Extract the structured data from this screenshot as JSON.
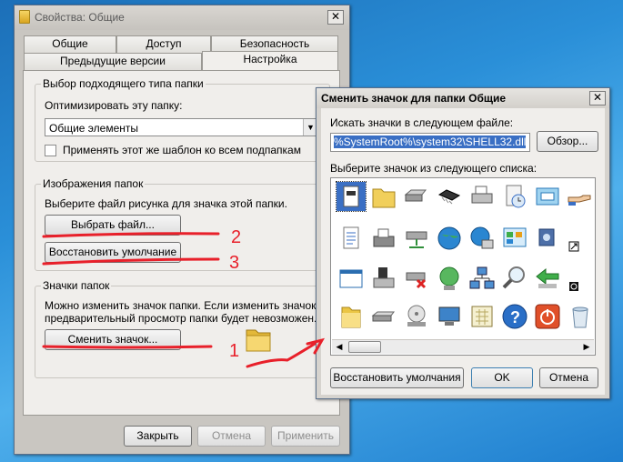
{
  "main": {
    "title": "Свойства: Общие",
    "tabs_row1": [
      "Общие",
      "Доступ",
      "Безопасность"
    ],
    "tabs_row2": [
      "Предыдущие версии",
      "Настройка"
    ],
    "group_type": {
      "title": "Выбор подходящего типа папки",
      "optimize_label": "Оптимизировать эту папку:",
      "combo_value": "Общие элементы",
      "apply_all_label": "Применять этот же шаблон ко всем подпапкам"
    },
    "group_images": {
      "title": "Изображения папок",
      "desc": "Выберите файл рисунка для значка этой папки.",
      "choose_file": "Выбрать файл...",
      "restore_default": "Восстановить умолчание"
    },
    "group_icons": {
      "title": "Значки папок",
      "desc_line1": "Можно изменить значок папки. Если изменить значок,",
      "desc_line2": "предварительный просмотр папки будет невозможен.",
      "change_icon": "Сменить значок..."
    },
    "footer": {
      "close": "Закрыть",
      "cancel": "Отмена",
      "apply": "Применить"
    }
  },
  "dialog": {
    "title": "Сменить значок для папки Общие",
    "search_label": "Искать значки в следующем файле:",
    "path_value": "%SystemRoot%\\system32\\SHELL32.dll",
    "browse": "Обзор...",
    "list_label": "Выберите значок из следующего списка:",
    "restore_defaults": "Восстановить умолчания",
    "ok": "OK",
    "cancel": "Отмена"
  },
  "annotations": [
    "1",
    "2",
    "3"
  ],
  "colors": {
    "annotation": "#e8202a",
    "selection": "#3a6fc4"
  },
  "icons": [
    "blank-document-icon",
    "folder-icon",
    "hard-drive-icon",
    "chip-icon",
    "printer-icon",
    "clock-document-icon",
    "window-icon",
    "hand-share-icon",
    "text-document-icon",
    "fax-icon",
    "network-drive-icon",
    "globe-icon",
    "network-globe-icon",
    "control-panel-icon",
    "audio-cd-icon",
    "shortcut-arrow-icon",
    "app-window-icon",
    "floppy-icon",
    "drive-x-icon",
    "globe-network-icon",
    "network-computers-icon",
    "magnifier-icon",
    "green-arrow-icon",
    "power-small-icon",
    "folder-open-icon",
    "drive-icon",
    "cd-drive-icon",
    "computer-icon",
    "calendar-icon",
    "help-icon",
    "power-icon",
    "recycle-bin-icon"
  ]
}
